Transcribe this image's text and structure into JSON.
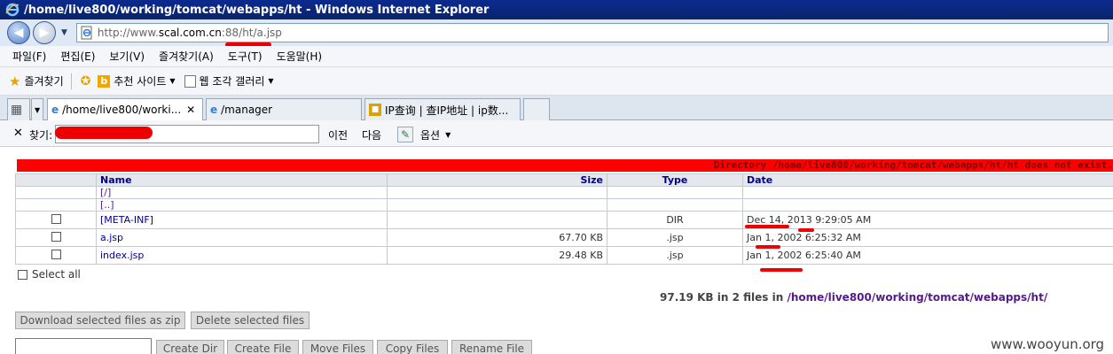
{
  "window": {
    "title": "/home/live800/working/tomcat/webapps/ht - Windows Internet Explorer"
  },
  "address": {
    "url_prefix": "http://www.",
    "url_host": "scal.com.cn",
    "url_suffix": ":88/ht/a.jsp"
  },
  "menu": {
    "items": [
      "파일(F)",
      "편집(E)",
      "보기(V)",
      "즐겨찾기(A)",
      "도구(T)",
      "도움말(H)"
    ]
  },
  "favorites": {
    "label": "즐겨찾기",
    "suggested_sites": "추천 사이트",
    "web_slice_gallery": "웹 조각 갤러리"
  },
  "tabs": [
    {
      "label": "/home/live800/worki...",
      "active": true
    },
    {
      "label": "/manager",
      "active": false
    },
    {
      "label": "IP查询 | 查IP地址 | ip数...",
      "active": false
    }
  ],
  "find": {
    "label": "찾기:",
    "prev": "이전",
    "next": "다음",
    "options": "옵션"
  },
  "page": {
    "error_message": "Directory /home/live800/working/tomcat/webapps/ht/ht does not exist.",
    "columns": {
      "name": "Name",
      "size": "Size",
      "type": "Type",
      "date": "Date"
    },
    "nav_links": [
      "[/]",
      "[..]"
    ],
    "files": [
      {
        "name": "[META-INF]",
        "size": "",
        "type": "DIR",
        "date": "Dec 14, 2013 9:29:05 AM"
      },
      {
        "name": "a.jsp",
        "size": "67.70 KB",
        "type": ".jsp",
        "date": "Jan 1, 2002 6:25:32 AM"
      },
      {
        "name": "index.jsp",
        "size": "29.48 KB",
        "type": ".jsp",
        "date": "Jan 1, 2002 6:25:40 AM"
      }
    ],
    "select_all": "Select all",
    "summary_prefix": "97.19 KB in 2 files in",
    "summary_path": "/home/live800/working/tomcat/webapps/ht/",
    "buttons": {
      "download": "Download selected files as zip",
      "delete": "Delete selected files",
      "create_dir": "Create Dir",
      "create_file": "Create File",
      "move_files": "Move Files",
      "copy_files": "Copy Files",
      "rename_file": "Rename File"
    },
    "watermark": "www.wooyun.org"
  },
  "colors": {
    "error_bg": "#ff0000",
    "annotation_red": "#ee0000",
    "header_text": "#00008b"
  }
}
